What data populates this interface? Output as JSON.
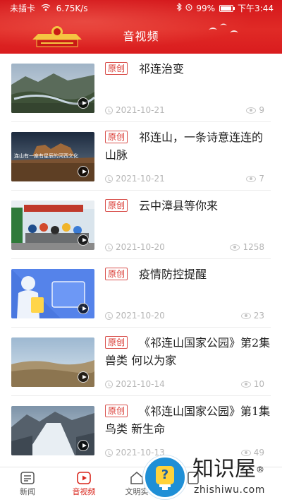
{
  "status_bar": {
    "carrier": "未插卡",
    "speed": "6.75K/s",
    "battery": "99%",
    "time": "下午3:44"
  },
  "header": {
    "title": "音视频",
    "background_color": "#d9261c"
  },
  "list": {
    "tag_label": "原创",
    "items": [
      {
        "title": "祁连治变",
        "date": "2021-10-21",
        "views": "9"
      },
      {
        "title": "祁连山，一条诗意连连的山脉",
        "thumb_caption": "连山有一座有星辰的河西文化",
        "date": "2021-10-21",
        "views": "7"
      },
      {
        "title": "云中漳县等你来",
        "date": "2021-10-20",
        "views": "1258"
      },
      {
        "title": "疫情防控提醒",
        "date": "2021-10-20",
        "views": "23"
      },
      {
        "title": "《祁连山国家公园》第2集 兽类 何以为家",
        "date": "2021-10-14",
        "views": "10"
      },
      {
        "title": "《祁连山国家公园》第1集 鸟类 新生命",
        "date": "2021-10-13",
        "views": "49"
      }
    ]
  },
  "tabbar": {
    "tabs": [
      {
        "label": "新闻"
      },
      {
        "label": "音视频"
      },
      {
        "label": "文明实"
      },
      {
        "label": ""
      }
    ],
    "active_color": "#d9261c"
  },
  "watermark": {
    "title": "知识屋",
    "registered": "®",
    "domain": "zhishiwu.com",
    "badge_glyph": "?"
  }
}
